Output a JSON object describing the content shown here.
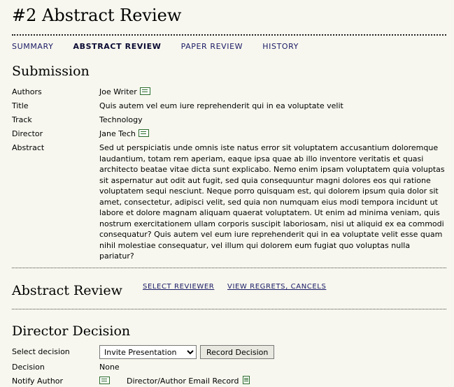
{
  "page": {
    "title": "#2 Abstract Review"
  },
  "tabs": [
    {
      "label": "SUMMARY"
    },
    {
      "label": "ABSTRACT REVIEW"
    },
    {
      "label": "PAPER REVIEW"
    },
    {
      "label": "HISTORY"
    }
  ],
  "submission": {
    "heading": "Submission",
    "authors_label": "Authors",
    "authors_value": "Joe Writer",
    "title_label": "Title",
    "title_value": "Quis autem vel eum iure reprehenderit qui in ea voluptate velit",
    "track_label": "Track",
    "track_value": "Technology",
    "director_label": "Director",
    "director_value": "Jane Tech",
    "abstract_label": "Abstract",
    "abstract_value": "Sed ut perspiciatis unde omnis iste natus error sit voluptatem accusantium doloremque laudantium, totam rem aperiam, eaque ipsa quae ab illo inventore veritatis et quasi architecto beatae vitae dicta sunt explicabo. Nemo enim ipsam voluptatem quia voluptas sit aspernatur aut odit aut fugit, sed quia consequuntur magni dolores eos qui ratione voluptatem sequi nesciunt. Neque porro quisquam est, qui dolorem ipsum quia dolor sit amet, consectetur, adipisci velit, sed quia non numquam eius modi tempora incidunt ut labore et dolore magnam aliquam quaerat voluptatem. Ut enim ad minima veniam, quis nostrum exercitationem ullam corporis suscipit laboriosam, nisi ut aliquid ex ea commodi consequatur? Quis autem vel eum iure reprehenderit qui in ea voluptate velit esse quam nihil molestiae consequatur, vel illum qui dolorem eum fugiat quo voluptas nulla pariatur?"
  },
  "abstract_review": {
    "heading": "Abstract Review",
    "select_reviewer": "SELECT REVIEWER",
    "view_regrets": "VIEW REGRETS, CANCELS"
  },
  "director_decision": {
    "heading": "Director Decision",
    "select_label": "Select decision",
    "select_value": "Invite Presentation",
    "record_button": "Record Decision",
    "decision_label": "Decision",
    "decision_value": "None",
    "notify_label": "Notify Author",
    "email_record": "Director/Author Email Record"
  },
  "colors": {
    "background": "#f7f7ef",
    "link": "#1a1a66",
    "icon": "#2a6b2a"
  }
}
